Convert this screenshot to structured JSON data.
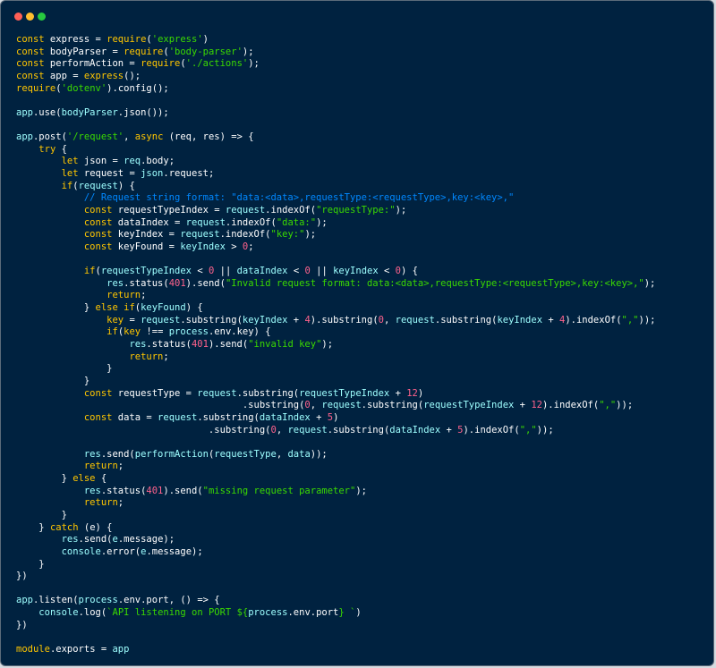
{
  "window": {
    "controls": {
      "close": "red",
      "minimize": "yellow",
      "maximize": "green"
    }
  },
  "theme": {
    "background": "#002240",
    "keyword": "#ffc600",
    "string": "#3ad900",
    "number": "#ff628c",
    "identifier": "#9effff",
    "comment": "#0088ff",
    "plain": "#ffffff"
  },
  "code": {
    "lines": [
      [
        [
          "kw",
          "const"
        ],
        [
          "pl",
          " express = "
        ],
        [
          "kw",
          "require"
        ],
        [
          "pl",
          "("
        ],
        [
          "str",
          "'express'"
        ],
        [
          "pl",
          ")"
        ]
      ],
      [
        [
          "kw",
          "const"
        ],
        [
          "pl",
          " bodyParser = "
        ],
        [
          "kw",
          "require"
        ],
        [
          "pl",
          "("
        ],
        [
          "str",
          "'body-parser'"
        ],
        [
          "pl",
          ");"
        ]
      ],
      [
        [
          "kw",
          "const"
        ],
        [
          "pl",
          " performAction = "
        ],
        [
          "kw",
          "require"
        ],
        [
          "pl",
          "("
        ],
        [
          "str",
          "'./actions'"
        ],
        [
          "pl",
          ");"
        ]
      ],
      [
        [
          "kw",
          "const"
        ],
        [
          "pl",
          " app = "
        ],
        [
          "kw",
          "express"
        ],
        [
          "pl",
          "();"
        ]
      ],
      [
        [
          "kw",
          "require"
        ],
        [
          "pl",
          "("
        ],
        [
          "str",
          "'dotenv'"
        ],
        [
          "pl",
          ").config();"
        ]
      ],
      [],
      [
        [
          "id",
          "app"
        ],
        [
          "pl",
          ".use("
        ],
        [
          "id",
          "bodyParser"
        ],
        [
          "pl",
          ".json());"
        ]
      ],
      [],
      [
        [
          "id",
          "app"
        ],
        [
          "pl",
          ".post("
        ],
        [
          "str",
          "'/request'"
        ],
        [
          "pl",
          ", "
        ],
        [
          "kw",
          "async"
        ],
        [
          "pl",
          " (req, res) => {"
        ]
      ],
      [
        [
          "pl",
          "    "
        ],
        [
          "kw",
          "try"
        ],
        [
          "pl",
          " {"
        ]
      ],
      [
        [
          "pl",
          "        "
        ],
        [
          "kw",
          "let"
        ],
        [
          "pl",
          " json = "
        ],
        [
          "id",
          "req"
        ],
        [
          "pl",
          ".body;"
        ]
      ],
      [
        [
          "pl",
          "        "
        ],
        [
          "kw",
          "let"
        ],
        [
          "pl",
          " request = "
        ],
        [
          "id",
          "json"
        ],
        [
          "pl",
          ".request;"
        ]
      ],
      [
        [
          "pl",
          "        "
        ],
        [
          "kw",
          "if"
        ],
        [
          "pl",
          "("
        ],
        [
          "id",
          "request"
        ],
        [
          "pl",
          ") {"
        ]
      ],
      [
        [
          "pl",
          "            "
        ],
        [
          "cm",
          "// Request string format: \"data:<data>,requestType:<requestType>,key:<key>,\""
        ]
      ],
      [
        [
          "pl",
          "            "
        ],
        [
          "kw",
          "const"
        ],
        [
          "pl",
          " requestTypeIndex = "
        ],
        [
          "id",
          "request"
        ],
        [
          "pl",
          ".indexOf("
        ],
        [
          "str",
          "\"requestType:\""
        ],
        [
          "pl",
          ");"
        ]
      ],
      [
        [
          "pl",
          "            "
        ],
        [
          "kw",
          "const"
        ],
        [
          "pl",
          " dataIndex = "
        ],
        [
          "id",
          "request"
        ],
        [
          "pl",
          ".indexOf("
        ],
        [
          "str",
          "\"data:\""
        ],
        [
          "pl",
          ");"
        ]
      ],
      [
        [
          "pl",
          "            "
        ],
        [
          "kw",
          "const"
        ],
        [
          "pl",
          " keyIndex = "
        ],
        [
          "id",
          "request"
        ],
        [
          "pl",
          ".indexOf("
        ],
        [
          "str",
          "\"key:\""
        ],
        [
          "pl",
          ");"
        ]
      ],
      [
        [
          "pl",
          "            "
        ],
        [
          "kw",
          "const"
        ],
        [
          "pl",
          " keyFound = "
        ],
        [
          "id",
          "keyIndex"
        ],
        [
          "pl",
          " > "
        ],
        [
          "num",
          "0"
        ],
        [
          "pl",
          ";"
        ]
      ],
      [],
      [
        [
          "pl",
          "            "
        ],
        [
          "kw",
          "if"
        ],
        [
          "pl",
          "("
        ],
        [
          "id",
          "requestTypeIndex"
        ],
        [
          "pl",
          " < "
        ],
        [
          "num",
          "0"
        ],
        [
          "pl",
          " || "
        ],
        [
          "id",
          "dataIndex"
        ],
        [
          "pl",
          " < "
        ],
        [
          "num",
          "0"
        ],
        [
          "pl",
          " || "
        ],
        [
          "id",
          "keyIndex"
        ],
        [
          "pl",
          " < "
        ],
        [
          "num",
          "0"
        ],
        [
          "pl",
          ") {"
        ]
      ],
      [
        [
          "pl",
          "                "
        ],
        [
          "id",
          "res"
        ],
        [
          "pl",
          ".status("
        ],
        [
          "num",
          "401"
        ],
        [
          "pl",
          ").send("
        ],
        [
          "str",
          "\"Invalid request format: data:<data>,requestType:<requestType>,key:<key>,\""
        ],
        [
          "pl",
          ");"
        ]
      ],
      [
        [
          "pl",
          "                "
        ],
        [
          "kw",
          "return"
        ],
        [
          "pl",
          ";"
        ]
      ],
      [
        [
          "pl",
          "            } "
        ],
        [
          "kw",
          "else if"
        ],
        [
          "pl",
          "("
        ],
        [
          "id",
          "keyFound"
        ],
        [
          "pl",
          ") {"
        ]
      ],
      [
        [
          "pl",
          "                "
        ],
        [
          "kw",
          "key"
        ],
        [
          "pl",
          " = "
        ],
        [
          "id",
          "request"
        ],
        [
          "pl",
          ".substring("
        ],
        [
          "id",
          "keyIndex"
        ],
        [
          "pl",
          " + "
        ],
        [
          "num",
          "4"
        ],
        [
          "pl",
          ").substring("
        ],
        [
          "num",
          "0"
        ],
        [
          "pl",
          ", "
        ],
        [
          "id",
          "request"
        ],
        [
          "pl",
          ".substring("
        ],
        [
          "id",
          "keyIndex"
        ],
        [
          "pl",
          " + "
        ],
        [
          "num",
          "4"
        ],
        [
          "pl",
          ").indexOf("
        ],
        [
          "str",
          "\",\""
        ],
        [
          "pl",
          "));"
        ]
      ],
      [
        [
          "pl",
          "                "
        ],
        [
          "kw",
          "if"
        ],
        [
          "pl",
          "("
        ],
        [
          "kw",
          "key"
        ],
        [
          "pl",
          " !== "
        ],
        [
          "id",
          "process"
        ],
        [
          "pl",
          ".env.key) {"
        ]
      ],
      [
        [
          "pl",
          "                    "
        ],
        [
          "id",
          "res"
        ],
        [
          "pl",
          ".status("
        ],
        [
          "num",
          "401"
        ],
        [
          "pl",
          ").send("
        ],
        [
          "str",
          "\"invalid key\""
        ],
        [
          "pl",
          ");"
        ]
      ],
      [
        [
          "pl",
          "                    "
        ],
        [
          "kw",
          "return"
        ],
        [
          "pl",
          ";"
        ]
      ],
      [
        [
          "pl",
          "                }"
        ]
      ],
      [
        [
          "pl",
          "            }"
        ]
      ],
      [
        [
          "pl",
          "            "
        ],
        [
          "kw",
          "const"
        ],
        [
          "pl",
          " requestType = "
        ],
        [
          "id",
          "request"
        ],
        [
          "pl",
          ".substring("
        ],
        [
          "id",
          "requestTypeIndex"
        ],
        [
          "pl",
          " + "
        ],
        [
          "num",
          "12"
        ],
        [
          "pl",
          ")"
        ]
      ],
      [
        [
          "pl",
          "                                        .substring("
        ],
        [
          "num",
          "0"
        ],
        [
          "pl",
          ", "
        ],
        [
          "id",
          "request"
        ],
        [
          "pl",
          ".substring("
        ],
        [
          "id",
          "requestTypeIndex"
        ],
        [
          "pl",
          " + "
        ],
        [
          "num",
          "12"
        ],
        [
          "pl",
          ").indexOf("
        ],
        [
          "str",
          "\",\""
        ],
        [
          "pl",
          "));"
        ]
      ],
      [
        [
          "pl",
          "            "
        ],
        [
          "kw",
          "const"
        ],
        [
          "pl",
          " data = "
        ],
        [
          "id",
          "request"
        ],
        [
          "pl",
          ".substring("
        ],
        [
          "id",
          "dataIndex"
        ],
        [
          "pl",
          " + "
        ],
        [
          "num",
          "5"
        ],
        [
          "pl",
          ")"
        ]
      ],
      [
        [
          "pl",
          "                                  .substring("
        ],
        [
          "num",
          "0"
        ],
        [
          "pl",
          ", "
        ],
        [
          "id",
          "request"
        ],
        [
          "pl",
          ".substring("
        ],
        [
          "id",
          "dataIndex"
        ],
        [
          "pl",
          " + "
        ],
        [
          "num",
          "5"
        ],
        [
          "pl",
          ").indexOf("
        ],
        [
          "str",
          "\",\""
        ],
        [
          "pl",
          "));"
        ]
      ],
      [],
      [
        [
          "pl",
          "            "
        ],
        [
          "id",
          "res"
        ],
        [
          "pl",
          ".send("
        ],
        [
          "id",
          "performAction"
        ],
        [
          "pl",
          "("
        ],
        [
          "id",
          "requestType"
        ],
        [
          "pl",
          ", "
        ],
        [
          "id",
          "data"
        ],
        [
          "pl",
          "));"
        ]
      ],
      [
        [
          "pl",
          "            "
        ],
        [
          "kw",
          "return"
        ],
        [
          "pl",
          ";"
        ]
      ],
      [
        [
          "pl",
          "        } "
        ],
        [
          "kw",
          "else"
        ],
        [
          "pl",
          " {"
        ]
      ],
      [
        [
          "pl",
          "            "
        ],
        [
          "id",
          "res"
        ],
        [
          "pl",
          ".status("
        ],
        [
          "num",
          "401"
        ],
        [
          "pl",
          ").send("
        ],
        [
          "str",
          "\"missing request parameter\""
        ],
        [
          "pl",
          ");"
        ]
      ],
      [
        [
          "pl",
          "            "
        ],
        [
          "kw",
          "return"
        ],
        [
          "pl",
          ";"
        ]
      ],
      [
        [
          "pl",
          "        }"
        ]
      ],
      [
        [
          "pl",
          "    } "
        ],
        [
          "kw",
          "catch"
        ],
        [
          "pl",
          " (e) {"
        ]
      ],
      [
        [
          "pl",
          "        "
        ],
        [
          "id",
          "res"
        ],
        [
          "pl",
          ".send("
        ],
        [
          "id",
          "e"
        ],
        [
          "pl",
          ".message);"
        ]
      ],
      [
        [
          "pl",
          "        "
        ],
        [
          "id",
          "console"
        ],
        [
          "pl",
          ".error("
        ],
        [
          "id",
          "e"
        ],
        [
          "pl",
          ".message);"
        ]
      ],
      [
        [
          "pl",
          "    }"
        ]
      ],
      [
        [
          "pl",
          "})"
        ]
      ],
      [],
      [
        [
          "id",
          "app"
        ],
        [
          "pl",
          ".listen("
        ],
        [
          "id",
          "process"
        ],
        [
          "pl",
          ".env.port, () => {"
        ]
      ],
      [
        [
          "pl",
          "    "
        ],
        [
          "id",
          "console"
        ],
        [
          "pl",
          ".log("
        ],
        [
          "str",
          "`API listening on PORT ${"
        ],
        [
          "id",
          "process"
        ],
        [
          "pl",
          ".env.port"
        ],
        [
          "str",
          "} `"
        ],
        [
          "pl",
          ")"
        ]
      ],
      [
        [
          "pl",
          "})"
        ]
      ],
      [],
      [
        [
          "kw",
          "module"
        ],
        [
          "pl",
          ".exports = "
        ],
        [
          "id",
          "app"
        ]
      ]
    ]
  }
}
